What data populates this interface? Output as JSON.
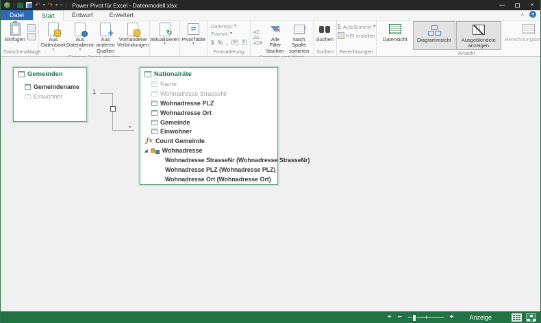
{
  "title_bar": {
    "title": "Power Pivot für Excel - Datenmodell.xlsx",
    "close": "×",
    "undo": "↶",
    "redo": "↷"
  },
  "tabs": {
    "file": "Datei",
    "start": "Start",
    "design": "Entwurf",
    "advanced": "Erweitert"
  },
  "ribbon": {
    "help": "?",
    "collapse": "˄",
    "clipboard": {
      "paste": "Einfügen",
      "group": "Zwischenablage"
    },
    "get_external": {
      "from_database": "Aus Datenbank",
      "from_service": "Aus Datendienst",
      "other_sources": "Aus anderen Quellen",
      "existing_connections": "Vorhandene Verbindungen",
      "group": "Externe Daten abrufen"
    },
    "refresh": {
      "label": "Aktualisieren"
    },
    "pivottable": {
      "label": "PivotTable"
    },
    "formatting": {
      "datatype": "Datentyp:",
      "format": "Format:",
      "currency": "$",
      "percent": "%",
      "thousands": ",",
      "dec_inc": "00",
      "dec_dec": "0",
      "group": "Formatierung"
    },
    "sort_filter": {
      "sort_az": "AZ↓",
      "sort_za": "ZA↓",
      "sort_clear": "AZ✗",
      "clear_filters": "Alle Filter löschen",
      "sort_by_column": "Nach Spalte sortieren",
      "group": "Sortieren und filtern"
    },
    "find": {
      "label": "Suchen",
      "group": "Suchen"
    },
    "calculations": {
      "sigma": "Σ",
      "autosum": "AutoSumme",
      "kpi": "KPI erstellen",
      "group": "Berechnungen"
    },
    "view": {
      "data_view": "Datensicht",
      "diagram_view": "Diagrammsicht",
      "show_hidden": "Ausgeblendete anzeigen",
      "calc_area": "Berechnungsbereich",
      "group": "Ansicht"
    }
  },
  "diagram": {
    "relationship": {
      "one": "1",
      "many": "*"
    },
    "gemeinden": {
      "name": "Gemeinden",
      "fields": [
        {
          "label": "Gemeindename"
        },
        {
          "label": "Einwohner"
        }
      ]
    },
    "nationalraete": {
      "name": "Nationalräte",
      "fields": [
        {
          "label": "Name"
        },
        {
          "label": "Wohnadresse StrasseNr"
        },
        {
          "label": "Wohnadresse PLZ"
        },
        {
          "label": "Wohnadresse Ort"
        },
        {
          "label": "Gemeinde"
        },
        {
          "label": "Einwohner"
        },
        {
          "label": "Count Gemeinde"
        },
        {
          "label": "Wohnadresse"
        },
        {
          "label": "Wohnadresse StrasseNr (Wohnadresse StrasseNr)"
        },
        {
          "label": "Wohnadresse PLZ (Wohnadresse PLZ)"
        },
        {
          "label": "Wohnadresse Ort (Wohnadresse Ort)"
        }
      ]
    }
  },
  "status_bar": {
    "zoom_out": "−",
    "zoom_in": "+",
    "display_label": "Anzeige"
  }
}
